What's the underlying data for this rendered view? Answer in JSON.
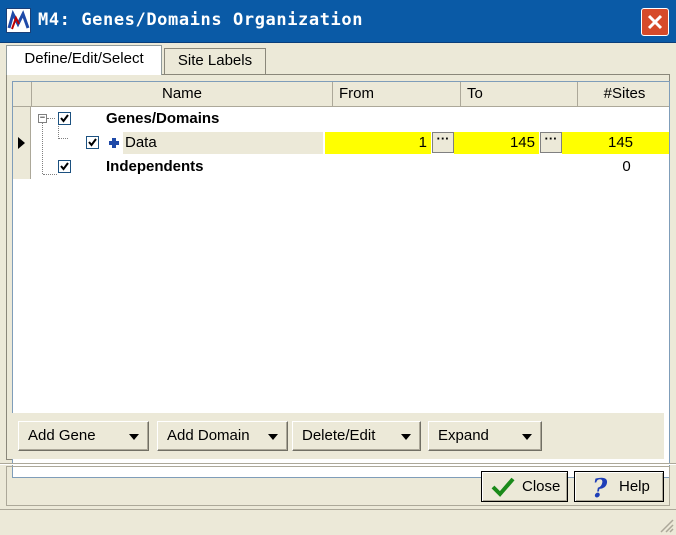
{
  "window": {
    "title": "M4: Genes/Domains Organization",
    "app_icon": "mega-logo-icon",
    "close_icon": "close-icon"
  },
  "tabs": [
    {
      "label": "Define/Edit/Select",
      "active": true
    },
    {
      "label": "Site Labels",
      "active": false
    }
  ],
  "grid": {
    "columns": [
      "Name",
      "From",
      "To",
      "#Sites"
    ],
    "rows": [
      {
        "name": "Genes/Domains",
        "checked": true,
        "bold": true,
        "expander": "−",
        "from": "",
        "to": "",
        "sites": ""
      },
      {
        "name": "Data",
        "checked": true,
        "bold": false,
        "current": true,
        "from": "1",
        "to": "145",
        "sites": "145",
        "picker": "···"
      },
      {
        "name": "Independents",
        "checked": true,
        "bold": true,
        "from": "",
        "to": "",
        "sites": "0"
      }
    ]
  },
  "buttons": {
    "add_gene": "Add Gene",
    "add_domain": "Add Domain",
    "delete_edit": "Delete/Edit",
    "expand": "Expand",
    "close": "Close",
    "help": "Help"
  },
  "colors": {
    "titlebar": "#0a5aa6",
    "highlight": "#ffff00",
    "face": "#ece9d8"
  }
}
